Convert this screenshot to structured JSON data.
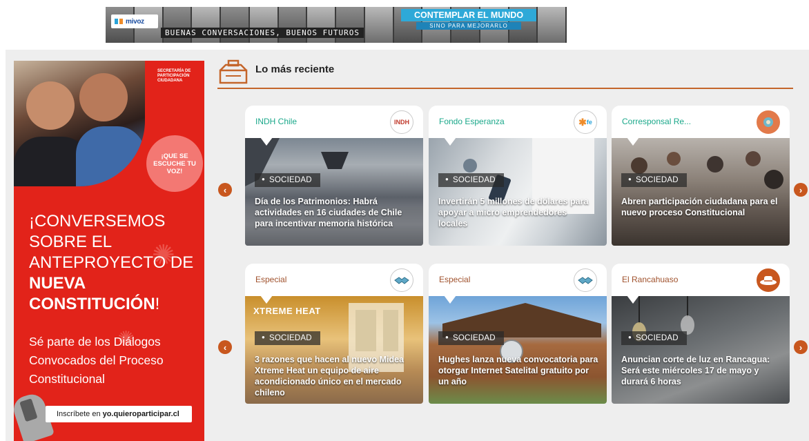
{
  "banner": {
    "logo_text": "mivoz",
    "tagline": "BUENAS CONVERSACIONES, BUENOS FUTUROS",
    "headline": "CONTEMPLAR EL MUNDO",
    "subheadline": "SINO PARA MEJORARLO"
  },
  "ad": {
    "org": "SECRETARÍA DE PARTICIPACIÓN CIUDADANA",
    "bubble": "¡QUE SE ESCUCHE TU VOZ!",
    "headline_plain": "¡CONVERSEMOS SOBRE EL ANTEPROYECTO DE ",
    "headline_bold": "NUEVA CONSTITUCIÓN",
    "headline_end": "!",
    "sub": "Sé parte de los Diálogos Convocados del Proceso Constitucional",
    "cta_plain": "Inscríbete en",
    "cta_bold": "yo.quieroparticipar.cl"
  },
  "section": {
    "title": "Lo más reciente"
  },
  "colors": {
    "accent": "#c4652a",
    "ad_red": "#e2231a",
    "source_teal": "#1aa88a",
    "source_brown": "#a0522d"
  },
  "nav": {
    "prev": "‹",
    "next": "›"
  },
  "rows": [
    {
      "cards": [
        {
          "source": "INDH Chile",
          "logo": "INDH",
          "category": "SOCIEDAD",
          "title": "Día de los Patrimonios: Habrá actividades en 16 ciudades de Chile para incentivar memoria histórica"
        },
        {
          "source": "Fondo Esperanza",
          "logo": "fe",
          "category": "SOCIEDAD",
          "title": "Invertirán 5 millones de dólares para apoyar a micro emprendedores locales"
        },
        {
          "source": "Corresponsal Re...",
          "logo": "",
          "category": "SOCIEDAD",
          "title": "Abren participación ciudadana para el nuevo proceso Constitucional"
        }
      ]
    },
    {
      "cards": [
        {
          "source": "Especial",
          "logo": "",
          "category": "SOCIEDAD",
          "title": "3 razones que hacen al nuevo Midea Xtreme Heat un equipo de aire acondicionado único en el mercado chileno",
          "image_text": "XTREME HEAT"
        },
        {
          "source": "Especial",
          "logo": "",
          "category": "SOCIEDAD",
          "title": "Hughes lanza nueva convocatoria para otorgar Internet Satelital gratuito por un año"
        },
        {
          "source": "El Rancahuaso",
          "logo": "",
          "category": "SOCIEDAD",
          "title": "Anuncian corte de luz en Rancagua: Será este miércoles 17 de mayo y durará 6 horas"
        }
      ]
    }
  ]
}
